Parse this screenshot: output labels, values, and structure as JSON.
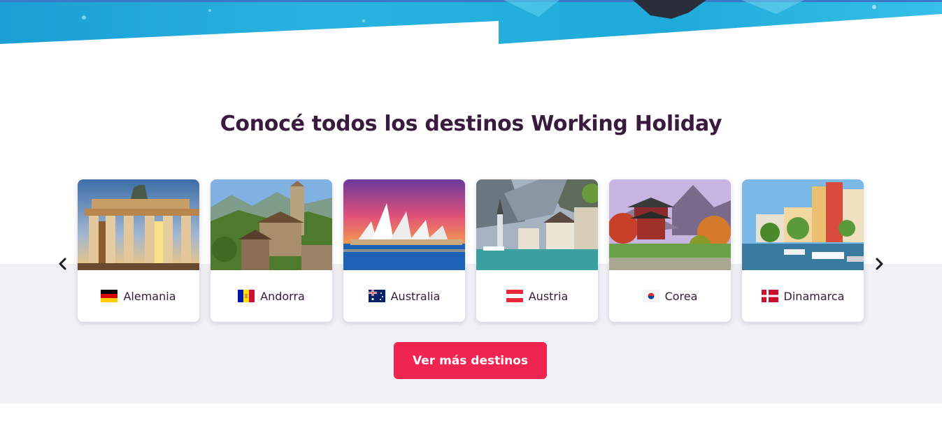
{
  "section": {
    "title": "Conocé todos los destinos Working Holiday"
  },
  "destinations": [
    {
      "name": "Alemania",
      "flag": "germany-flag-icon",
      "image": "brandenburg-gate"
    },
    {
      "name": "Andorra",
      "flag": "andorra-flag-icon",
      "image": "mountain-village-church"
    },
    {
      "name": "Australia",
      "flag": "australia-flag-icon",
      "image": "sydney-opera-house"
    },
    {
      "name": "Austria",
      "flag": "austria-flag-icon",
      "image": "hallstatt-lake-village"
    },
    {
      "name": "Corea",
      "flag": "korea-flag-icon",
      "image": "korean-pavilion"
    },
    {
      "name": "Dinamarca",
      "flag": "denmark-flag-icon",
      "image": "copenhagen-nyhavn"
    }
  ],
  "cta": {
    "label": "Ver más destinos"
  },
  "colors": {
    "title": "#3a1a3e",
    "accent": "#ef2451",
    "band": "#f0f0f5",
    "hero": "#2ab3e0"
  },
  "icons": {
    "prev": "chevron-left-icon",
    "next": "chevron-right-icon"
  }
}
